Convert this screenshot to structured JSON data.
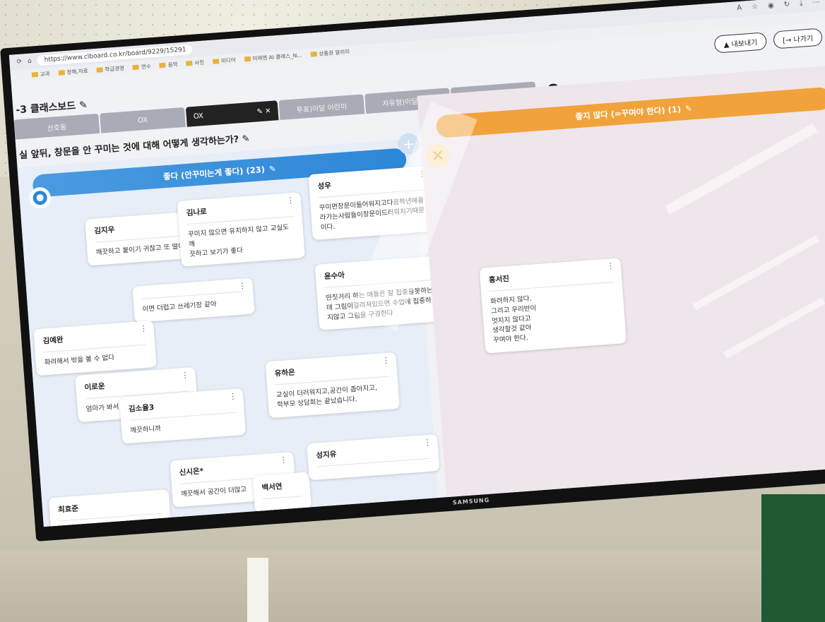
{
  "browser": {
    "url": "https://www.clboard.co.kr/board/9229/15291",
    "bookmarks": [
      "교과",
      "장해,자료",
      "학급경영",
      "연수",
      "음악",
      "사진",
      "미디어",
      "미래엔 AI 클래스_N...",
      "상품권 알리미"
    ]
  },
  "actions": {
    "export_label": "내보내기",
    "exit_label": "나가기"
  },
  "board": {
    "title": "-3 클래스보드"
  },
  "tabs": [
    {
      "label": "산호동",
      "active": false
    },
    {
      "label": "OX",
      "active": false
    },
    {
      "label": "OX",
      "active": true
    },
    {
      "label": "투표)이달 어린이",
      "active": false
    },
    {
      "label": "자유형)이달 반성",
      "active": false
    },
    {
      "label": "자유형)선생님",
      "active": false
    }
  ],
  "question": "실 앞뒤, 창문을 안 꾸미는 것에 대해 어떻게 생각하는가?",
  "columns": {
    "left": {
      "title": "좋다 (안꾸미는게 좋다) (23)",
      "symbol": "O",
      "color": "#2d87d8"
    },
    "right": {
      "title": "좋지 않다 (=꾸며야 한다) (1)",
      "symbol": "X",
      "color": "#f1a23a"
    }
  },
  "cards_left": [
    {
      "author": "김지우",
      "body": "깨끗하고 붙이기 귀찮고 또 떨어져"
    },
    {
      "author": "김나로",
      "body": "꾸미지 않으면 유치하지 않고 교실도 깨\n끗하고 보기가 좋다"
    },
    {
      "author": "성우",
      "body": "꾸미면창문이들어워지고다음학년에올\n라가는사람들이창문이드러워지기때문\n이다."
    },
    {
      "author": "김예완",
      "body": "화려해서 밖을 볼 수 없다"
    },
    {
      "author": "",
      "body": "이면 더럽고 쓰레기장 같아"
    },
    {
      "author": "윤수아",
      "body": "딴짓거리 하는 애들은 잘 집중을못하는\n데 그림이걸려져있으면 수업에 집중하\n지않고 그림을 구경한다"
    },
    {
      "author": "이로운",
      "body": "엄마가 봐서"
    },
    {
      "author": "김소율3",
      "body": "깨끗하니까"
    },
    {
      "author": "유하은",
      "body": "교실이 더러워지고,공간이 좁아지고,\n학부모 상담회는 끝났습니다."
    },
    {
      "author": "신시온*",
      "body": "깨끗해서 공간이 더많고"
    },
    {
      "author": "백서연",
      "body": ""
    },
    {
      "author": "성지유",
      "body": ""
    },
    {
      "author": "최효준",
      "body": ""
    }
  ],
  "cards_right": [
    {
      "author": "홍서진",
      "body": "화려하지 않다.\n그리고 우리반이\n멋지지 않다고\n생각할것 같아\n꾸며야 한다."
    }
  ],
  "monitor_brand": "SAMSUNG"
}
